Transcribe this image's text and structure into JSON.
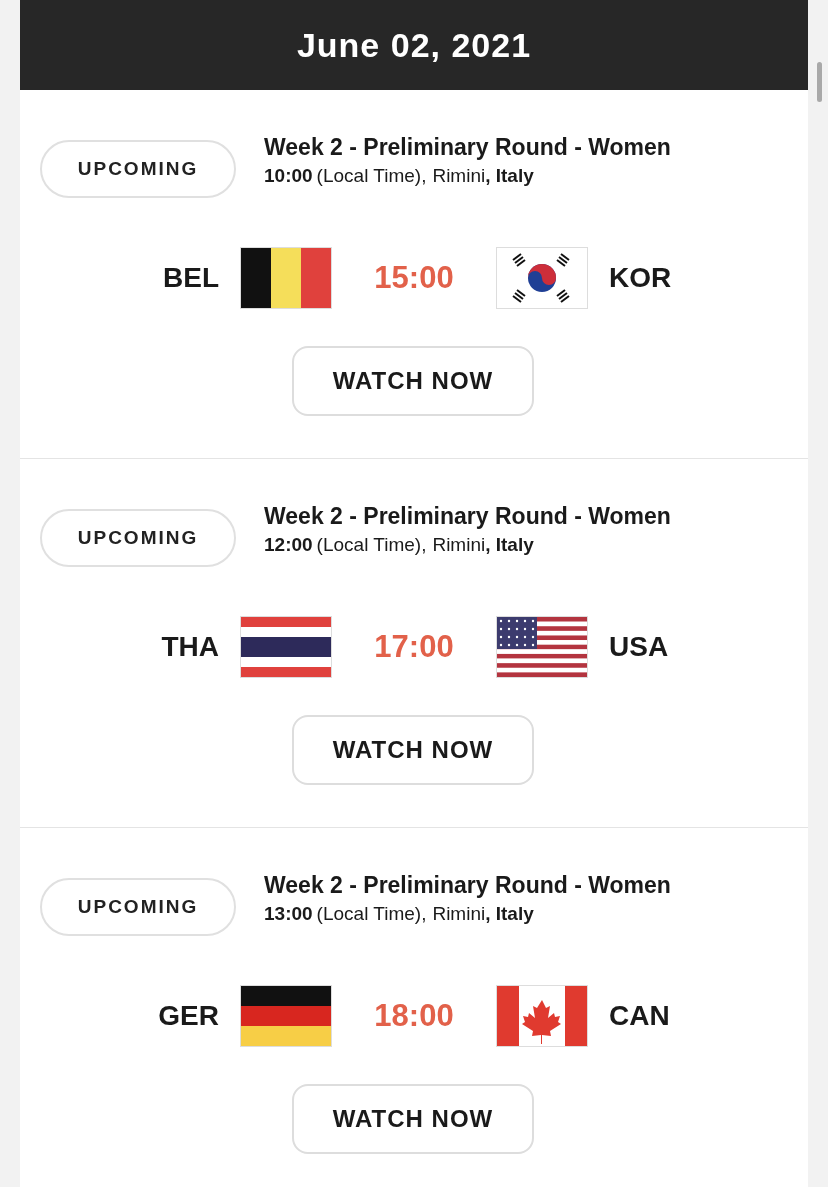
{
  "header": {
    "date": "June 02, 2021"
  },
  "matches": [
    {
      "status": "UPCOMING",
      "title": "Week 2 - Preliminary Round - Women",
      "time": "10:00",
      "time_note": "(Local Time),",
      "city": "Rimini",
      "country": ", Italy",
      "home": {
        "code": "BEL",
        "kind": "belgium"
      },
      "kickoff": "15:00",
      "away": {
        "code": "KOR",
        "kind": "korea"
      },
      "button": "WATCH NOW"
    },
    {
      "status": "UPCOMING",
      "title": "Week 2 - Preliminary Round - Women",
      "time": "12:00",
      "time_note": "(Local Time),",
      "city": "Rimini",
      "country": ", Italy",
      "home": {
        "code": "THA",
        "kind": "thailand"
      },
      "kickoff": "17:00",
      "away": {
        "code": "USA",
        "kind": "usa"
      },
      "button": "WATCH NOW"
    },
    {
      "status": "UPCOMING",
      "title": "Week 2 - Preliminary Round - Women",
      "time": "13:00",
      "time_note": "(Local Time),",
      "city": "Rimini",
      "country": ", Italy",
      "home": {
        "code": "GER",
        "kind": "germany"
      },
      "kickoff": "18:00",
      "away": {
        "code": "CAN",
        "kind": "canada"
      },
      "button": "WATCH NOW"
    }
  ]
}
